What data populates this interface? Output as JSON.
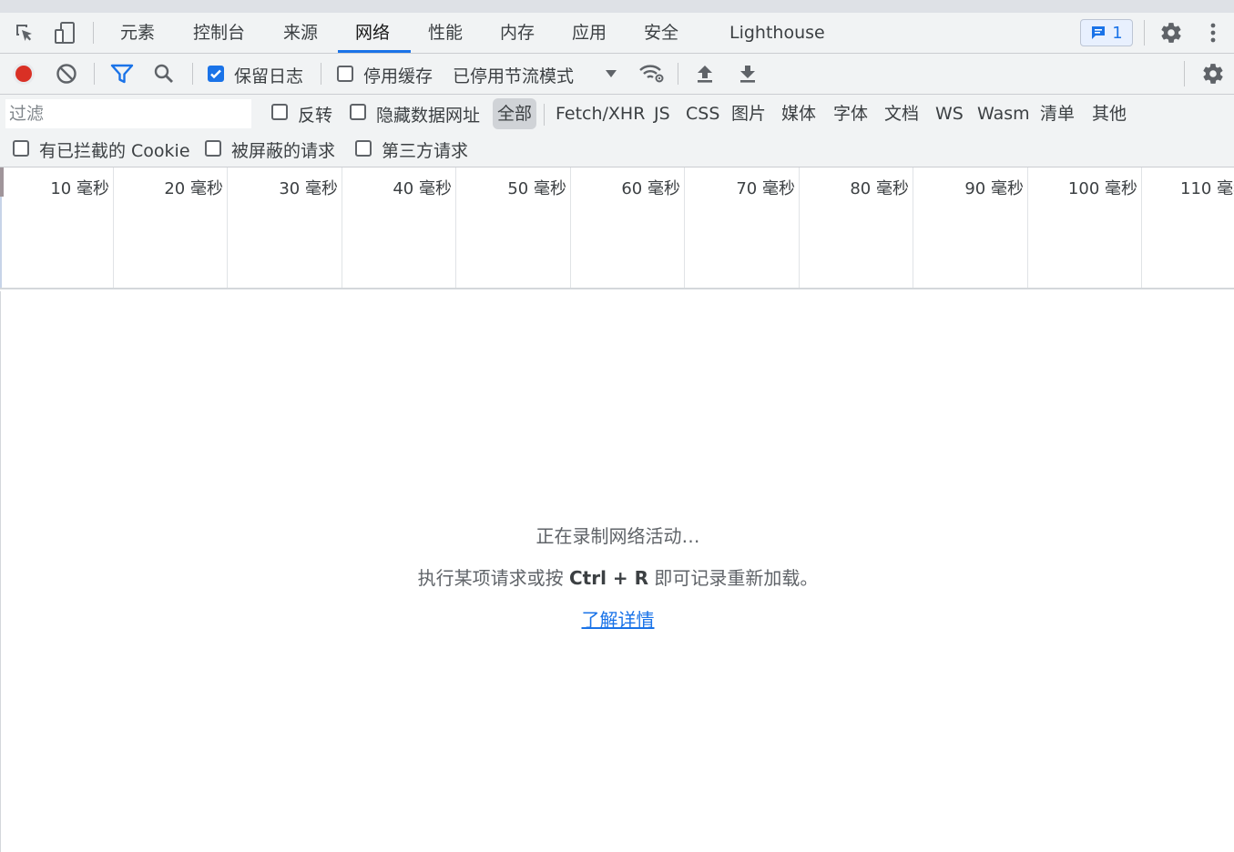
{
  "main_tabs": [
    "元素",
    "控制台",
    "来源",
    "网络",
    "性能",
    "内存",
    "应用",
    "安全",
    "Lighthouse"
  ],
  "issues_badge": {
    "count": "1"
  },
  "toolbar": {
    "preserve_log": {
      "label": "保留日志",
      "checked": true
    },
    "disable_cache": {
      "label": "停用缓存",
      "checked": false
    },
    "throttling": "已停用节流模式"
  },
  "filter": {
    "placeholder": "过滤",
    "invert": "反转",
    "hide_data_urls": "隐藏数据网址",
    "types": [
      "全部",
      "Fetch/XHR",
      "JS",
      "CSS",
      "图片",
      "媒体",
      "字体",
      "文档",
      "WS",
      "Wasm",
      "清单",
      "其他"
    ],
    "selected_type": "全部",
    "blocked_cookies": "有已拦截的 Cookie",
    "blocked_requests": "被屏蔽的请求",
    "third_party": "第三方请求"
  },
  "timeline": {
    "ticks": [
      "10 毫秒",
      "20 毫秒",
      "30 毫秒",
      "40 毫秒",
      "50 毫秒",
      "60 毫秒",
      "70 毫秒",
      "80 毫秒",
      "90 毫秒",
      "100 毫秒",
      "110 毫秒"
    ]
  },
  "empty_state": {
    "title": "正在录制网络活动…",
    "hint_prefix": "执行某项请求或按",
    "hint_shortcut": "Ctrl + R",
    "hint_suffix": "即可记录重新加载。",
    "link": "了解详情"
  },
  "colors": {
    "accent": "#1a73e8",
    "record": "#d93025"
  }
}
